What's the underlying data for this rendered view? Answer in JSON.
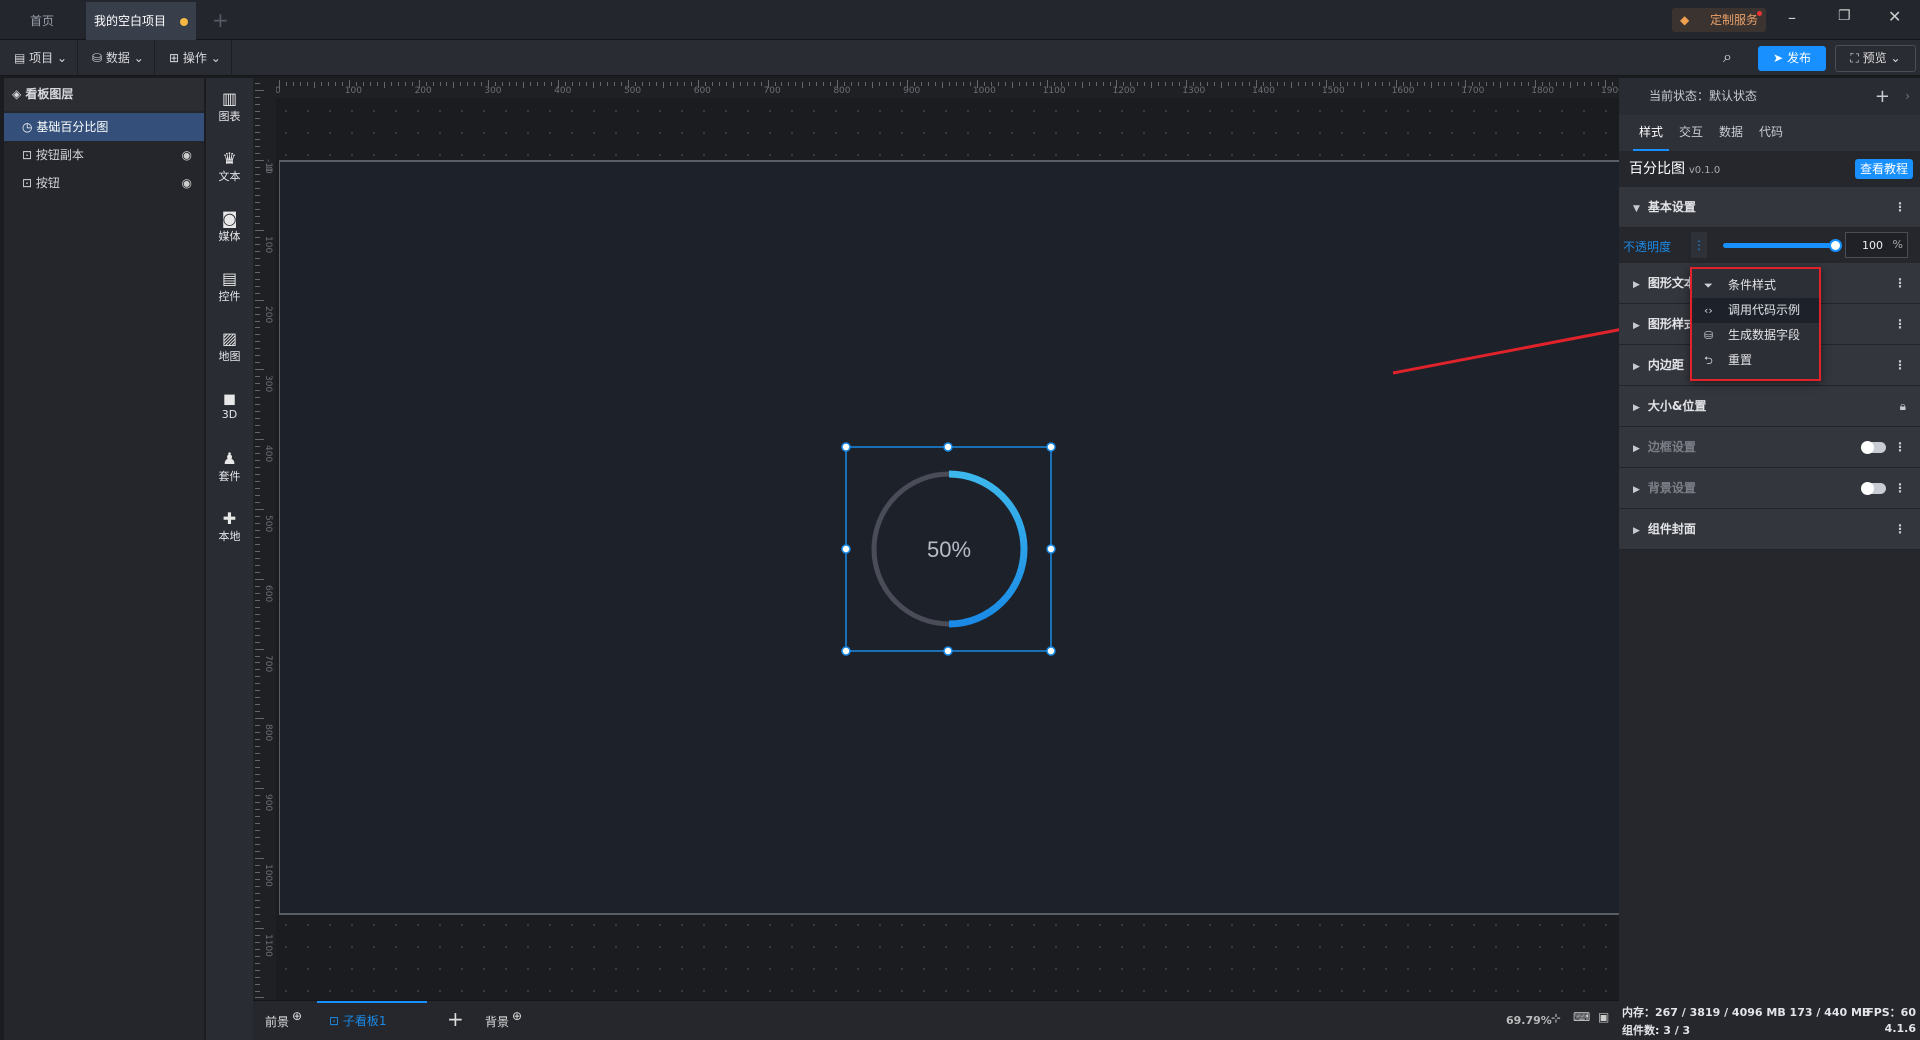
{
  "tabs": [
    {
      "label": "首页",
      "active": false
    },
    {
      "label": "我的空白项目",
      "active": true,
      "unsaved": true
    }
  ],
  "window": {
    "custom_service": "定制服务"
  },
  "toolbar": {
    "menus": [
      "项目",
      "数据",
      "操作"
    ],
    "publish": "发布",
    "preview": "预览"
  },
  "layers": {
    "title": "看板图层",
    "items": [
      {
        "label": "基础百分比图",
        "selected": true
      },
      {
        "label": "按钮副本",
        "hidden": true
      },
      {
        "label": "按钮",
        "hidden": true
      }
    ]
  },
  "components": [
    {
      "label": "图表",
      "icon": "bar-chart-icon"
    },
    {
      "label": "文本",
      "icon": "crown-icon"
    },
    {
      "label": "媒体",
      "icon": "camera-icon"
    },
    {
      "label": "控件",
      "icon": "list-icon"
    },
    {
      "label": "地图",
      "icon": "map-icon"
    },
    {
      "label": "3D",
      "icon": "cube-icon"
    },
    {
      "label": "套件",
      "icon": "shirt-icon"
    },
    {
      "label": "本地",
      "icon": "puzzle-icon"
    }
  ],
  "ruler": {
    "top": [
      "0",
      "100",
      "200",
      "300",
      "400",
      "500",
      "600",
      "700",
      "800",
      "900",
      "1000",
      "1100",
      "1200",
      "1300",
      "1400",
      "1500",
      "1600",
      "1700",
      "1800",
      "1900"
    ],
    "left": [
      "-10",
      "0",
      "100",
      "200",
      "300",
      "400",
      "500",
      "600",
      "700",
      "800",
      "900",
      "1000",
      "1100"
    ]
  },
  "widget": {
    "label": "50%",
    "percent": 50,
    "track_color": "#4a4d57",
    "arc_color_start": "#3db8ec",
    "arc_color_end": "#1a8ae6"
  },
  "right": {
    "state_label": "当前状态：默认状态",
    "tabs": [
      "样式",
      "交互",
      "数据",
      "代码"
    ],
    "active_tab": "样式",
    "component_name": "百分比图",
    "version": "v0.1.0",
    "tutorial": "查看教程",
    "sections": [
      {
        "label": "基本设置",
        "expanded": true
      },
      {
        "label": "图形文本"
      },
      {
        "label": "图形样式"
      },
      {
        "label": "内边距"
      },
      {
        "label": "大小&位置",
        "locked": true
      },
      {
        "label": "边框设置",
        "toggle": false
      },
      {
        "label": "背景设置",
        "toggle": false
      },
      {
        "label": "组件封面"
      }
    ],
    "opacity": {
      "label": "不透明度",
      "value": "100",
      "unit": "%",
      "fraction": 1.0
    }
  },
  "context_menu": [
    {
      "label": "条件样式",
      "icon": "filter-icon"
    },
    {
      "label": "调用代码示例",
      "icon": "code-icon",
      "hover": true
    },
    {
      "label": "生成数据字段",
      "icon": "database-icon"
    },
    {
      "label": "重置",
      "icon": "reset-icon"
    }
  ],
  "bottom": {
    "foreground": "前景",
    "board": "子看板1",
    "background": "背景",
    "zoom": "69.79%"
  },
  "status": {
    "memory": "内存：267 / 3819 / 4096 MB  173 / 440 MB",
    "fps": "FPS：60",
    "count": "组件数: 3 / 3",
    "version": "4.1.6"
  },
  "colors": {
    "accent": "#1890ff",
    "annotation": "#e0222a"
  }
}
